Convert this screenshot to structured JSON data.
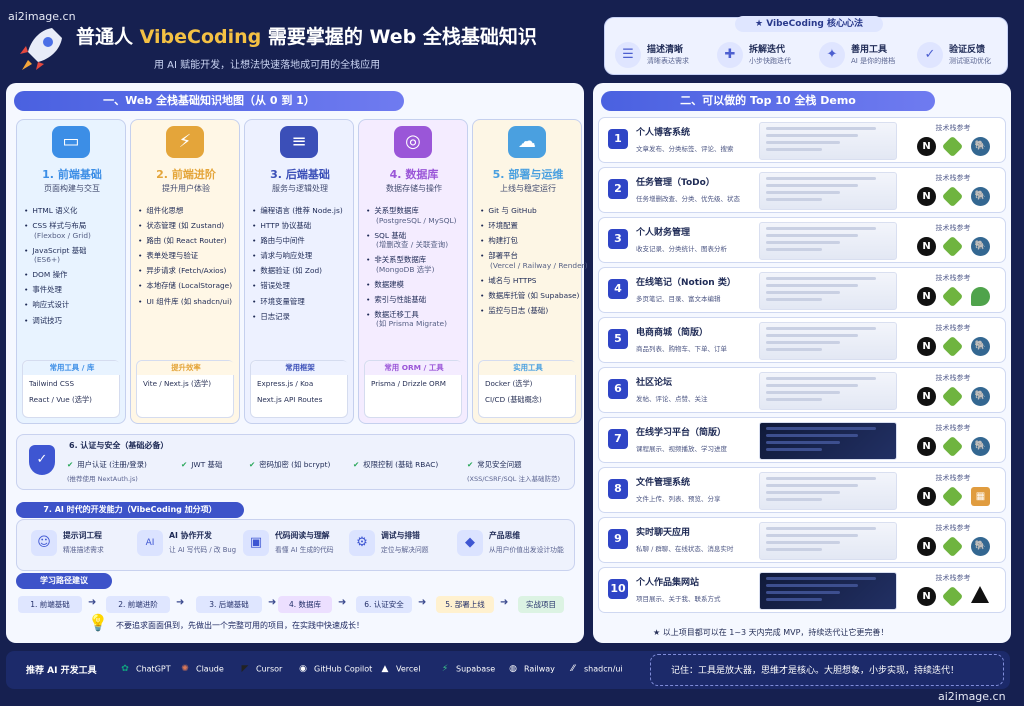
{
  "watermarks": {
    "top_left": "ai2image.cn",
    "bottom_right": "ai2image.cn"
  },
  "header": {
    "title_prefix": "普通人 ",
    "title_highlight": "VibeCoding",
    "title_suffix": " 需要掌握的 Web 全栈基础知识",
    "subtitle": "用 AI 赋能开发，让想法快速落地成可用的全栈应用",
    "icon": "rocket-icon"
  },
  "core": {
    "title": "VibeCoding 核心心法",
    "items": [
      {
        "title": "描述清晰",
        "desc": "清晰表达需求",
        "icon": "chat-icon"
      },
      {
        "title": "拆解迭代",
        "desc": "小步快跑迭代",
        "icon": "puzzle-icon"
      },
      {
        "title": "善用工具",
        "desc": "AI 是你的搭档",
        "icon": "magic-wand-icon"
      },
      {
        "title": "验证反馈",
        "desc": "测试驱动优化",
        "icon": "check-icon"
      }
    ]
  },
  "left": {
    "title": "一、Web 全栈基础知识地图（从 0 到 1）",
    "columns": [
      {
        "title": "1. 前端基础",
        "sub": "页面构建与交互",
        "color": "#3c8ee6",
        "bg": "#e8f3ff",
        "icon": "monitor-icon",
        "items": [
          [
            "HTML 语义化",
            ""
          ],
          [
            "CSS 样式与布局",
            "(Flexbox / Grid)"
          ],
          [
            "JavaScript 基础",
            "(ES6+)"
          ],
          [
            "DOM 操作",
            ""
          ],
          [
            "事件处理",
            ""
          ],
          [
            "响应式设计",
            ""
          ],
          [
            "调试技巧",
            ""
          ]
        ],
        "tools_title": "常用工具 / 库",
        "tools": [
          "Tailwind CSS",
          "React / Vue (选学)"
        ]
      },
      {
        "title": "2. 前端进阶",
        "sub": "提升用户体验",
        "color": "#e4a53a",
        "bg": "#fff7e6",
        "icon": "lightning-icon",
        "items": [
          [
            "组件化思想",
            ""
          ],
          [
            "状态管理 (如 Zustand)",
            ""
          ],
          [
            "路由 (如 React Router)",
            ""
          ],
          [
            "表单处理与验证",
            ""
          ],
          [
            "异步请求 (Fetch/Axios)",
            ""
          ],
          [
            "本地存储 (LocalStorage)",
            ""
          ],
          [
            "UI 组件库 (如 shadcn/ui)",
            ""
          ]
        ],
        "tools_title": "提升效率",
        "tools": [
          "Vite / Next.js (选学)"
        ]
      },
      {
        "title": "3. 后端基础",
        "sub": "服务与逻辑处理",
        "color": "#3b4fb8",
        "bg": "#edf1ff",
        "icon": "server-icon",
        "items": [
          [
            "编程语言 (推荐 Node.js)",
            ""
          ],
          [
            "HTTP 协议基础",
            ""
          ],
          [
            "路由与中间件",
            ""
          ],
          [
            "请求与响应处理",
            ""
          ],
          [
            "数据验证 (如 Zod)",
            ""
          ],
          [
            "错误处理",
            ""
          ],
          [
            "环境变量管理",
            ""
          ],
          [
            "日志记录",
            ""
          ]
        ],
        "tools_title": "常用框架",
        "tools": [
          "Express.js / Koa",
          "Next.js API Routes"
        ]
      },
      {
        "title": "4. 数据库",
        "sub": "数据存储与操作",
        "color": "#9a56d8",
        "bg": "#f4ecff",
        "icon": "database-icon",
        "items": [
          [
            "关系型数据库",
            "(PostgreSQL / MySQL)"
          ],
          [
            "SQL 基础",
            "(增删改查 / 关联查询)"
          ],
          [
            "非关系型数据库",
            "(MongoDB 选学)"
          ],
          [
            "数据建模",
            ""
          ],
          [
            "索引与性能基础",
            ""
          ],
          [
            "数据迁移工具",
            "(如 Prisma Migrate)"
          ]
        ],
        "tools_title": "常用 ORM / 工具",
        "tools": [
          "Prisma / Drizzle ORM"
        ]
      },
      {
        "title": "5. 部署与运维",
        "sub": "上线与稳定运行",
        "color": "#4aa0e0",
        "bg": "#fdf6e5",
        "icon": "cloud-icon",
        "items": [
          [
            "Git 与 GitHub",
            ""
          ],
          [
            "环境配置",
            ""
          ],
          [
            "构建打包",
            ""
          ],
          [
            "部署平台",
            "(Vercel / Railway / Render)"
          ],
          [
            "域名与 HTTPS",
            ""
          ],
          [
            "数据库托管 (如 Supabase)",
            ""
          ],
          [
            "监控与日志 (基础)",
            ""
          ]
        ],
        "tools_title": "实用工具",
        "tools": [
          "Docker (选学)",
          "CI/CD (基础概念)"
        ]
      }
    ],
    "auth": {
      "title": "6. 认证与安全（基础必备）",
      "items": [
        {
          "t": "用户认证 (注册/登录)",
          "s": "(推荐使用 NextAuth.js)"
        },
        {
          "t": "JWT 基础",
          "s": ""
        },
        {
          "t": "密码加密 (如 bcrypt)",
          "s": ""
        },
        {
          "t": "权限控制 (基础 RBAC)",
          "s": ""
        },
        {
          "t": "常见安全问题",
          "s": "(XSS/CSRF/SQL 注入基础防范)"
        }
      ]
    },
    "ai": {
      "title": "7. AI 时代的开发能力（VibeCoding 加分项）",
      "items": [
        {
          "t": "提示词工程",
          "s": "精准描述需求",
          "icon": "brain-icon"
        },
        {
          "t": "AI 协作开发",
          "s": "让 AI 写代码 / 改 Bug",
          "icon": "ai-icon"
        },
        {
          "t": "代码阅读与理解",
          "s": "看懂 AI 生成的代码",
          "icon": "code-icon"
        },
        {
          "t": "调试与排错",
          "s": "定位与解决问题",
          "icon": "debug-icon"
        },
        {
          "t": "产品思维",
          "s": "从用户价值出发设计功能",
          "icon": "product-icon"
        }
      ]
    },
    "path": {
      "title": "学习路径建议",
      "steps": [
        "1. 前端基础",
        "2. 前端进阶",
        "3. 后端基础",
        "4. 数据库",
        "6. 认证安全",
        "5. 部署上线",
        "实战项目"
      ],
      "tip": "不要追求面面俱到，先做出一个完整可用的项目，在实践中快速成长！"
    }
  },
  "right": {
    "title": "二、可以做的 Top 10 全栈 Demo",
    "tech_label": "技术栈参考",
    "demos": [
      {
        "n": "1",
        "t": "个人博客系统",
        "d": "文章发布、分类标签、评论、搜索",
        "stack": [
          "next",
          "node",
          "pg"
        ]
      },
      {
        "n": "2",
        "t": "任务管理（ToDo）",
        "d": "任务增删改查、分类、优先级、状态",
        "stack": [
          "next",
          "node",
          "pg"
        ]
      },
      {
        "n": "3",
        "t": "个人财务管理",
        "d": "收支记录、分类统计、图表分析",
        "stack": [
          "next",
          "node",
          "pg"
        ]
      },
      {
        "n": "4",
        "t": "在线笔记（Notion 类）",
        "d": "多页笔记、目录、富文本编辑",
        "stack": [
          "next",
          "node",
          "mongo"
        ]
      },
      {
        "n": "5",
        "t": "电商商城（简版）",
        "d": "商品列表、购物车、下单、订单",
        "stack": [
          "next",
          "node",
          "pg"
        ]
      },
      {
        "n": "6",
        "t": "社区论坛",
        "d": "发帖、评论、点赞、关注",
        "stack": [
          "next",
          "node",
          "pg"
        ]
      },
      {
        "n": "7",
        "t": "在线学习平台（简版）",
        "d": "课程展示、视频播放、学习进度",
        "stack": [
          "next",
          "node",
          "pg"
        ]
      },
      {
        "n": "8",
        "t": "文件管理系统",
        "d": "文件上传、列表、预览、分享",
        "stack": [
          "next",
          "node",
          "box"
        ]
      },
      {
        "n": "9",
        "t": "实时聊天应用",
        "d": "私聊 / 群聊、在线状态、消息实时",
        "stack": [
          "next",
          "node",
          "pg"
        ]
      },
      {
        "n": "10",
        "t": "个人作品集网站",
        "d": "项目展示、关于我、联系方式",
        "stack": [
          "next",
          "node",
          "tri"
        ]
      }
    ],
    "note": "以上项目都可以在 1~3 天内完成 MVP，持续迭代让它更完善！"
  },
  "bottom": {
    "label": "推荐 AI 开发工具",
    "tools": [
      "ChatGPT",
      "Claude",
      "Cursor",
      "GitHub Copilot",
      "Vercel",
      "Supabase",
      "Railway",
      "shadcn/ui"
    ],
    "remember": "记住：工具是放大器，思维才是核心。大胆想象，小步实现，持续迭代！"
  }
}
